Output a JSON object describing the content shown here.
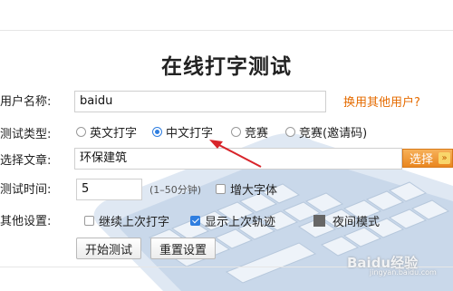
{
  "page_title": "在线打字测试",
  "username": {
    "label": "用户名称:",
    "value": "baidu",
    "switch_link": "换用其他用户?"
  },
  "test_type": {
    "label": "测试类型:",
    "options": [
      "英文打字",
      "中文打字",
      "竞赛",
      "竞赛(邀请码)"
    ],
    "selected": "中文打字"
  },
  "article": {
    "label": "选择文章:",
    "value": "环保建筑",
    "select_button": "选择"
  },
  "test_time": {
    "label": "测试时间:",
    "value": "5",
    "hint": "(1–50分钟)",
    "large_font_label": "增大字体",
    "large_font_checked": false
  },
  "other": {
    "label": "其他设置:",
    "continue_label": "继续上次打字",
    "continue_checked": false,
    "show_track_label": "显示上次轨迹",
    "show_track_checked": true,
    "night_mode_label": "夜间模式"
  },
  "buttons": {
    "start": "开始测试",
    "reset": "重置设置"
  },
  "watermark": {
    "text": "Baidu经验",
    "sub": "jingyan.baidu.com"
  },
  "colors": {
    "accent_orange": "#e56b00",
    "radio_blue": "#2f7ee0",
    "annotation_red": "#d8242a",
    "keyboard_blue": "#c9d8ea"
  }
}
